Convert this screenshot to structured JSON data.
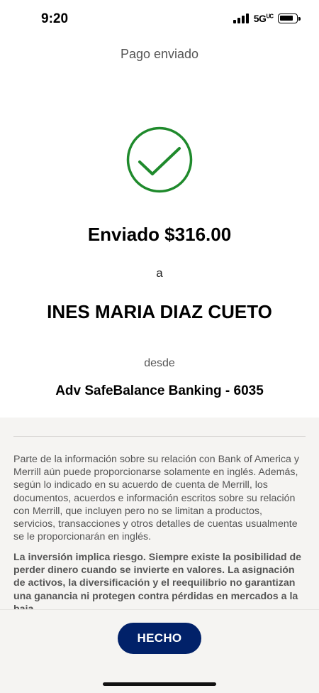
{
  "status_bar": {
    "time": "9:20",
    "network": "5G",
    "network_sup": "UC",
    "battery_level": 0.8
  },
  "header": {
    "title": "Pago enviado"
  },
  "confirmation": {
    "icon": "checkmark-circle-icon",
    "icon_color": "#1f8a2c",
    "amount_text": "Enviado $316.00",
    "to_word": "a",
    "recipient": "INES MARIA DIAZ CUETO",
    "from_word": "desde",
    "account": "Adv SafeBalance Banking - 6035"
  },
  "disclosure": {
    "paragraph1": "Parte de la información sobre su relación con Bank of America y Merrill aún puede proporcionarse solamente en inglés. Además, según lo indicado en su acuerdo de cuenta de Merrill, los documentos, acuerdos e información escritos sobre su relación con Merrill, que incluyen pero no se limitan a productos, servicios, transacciones y otros detalles de cuentas usualmente se le proporcionarán en inglés.",
    "paragraph2": "La inversión implica riesgo. Siempre existe la posibilidad de perder dinero cuando se invierte en valores. La asignación de activos, la diversificación y el reequilibrio no garantizan una ganancia ni protegen contra pérdidas en mercados a la baja."
  },
  "footer": {
    "done_label": "HECHO",
    "button_color": "#012169"
  }
}
